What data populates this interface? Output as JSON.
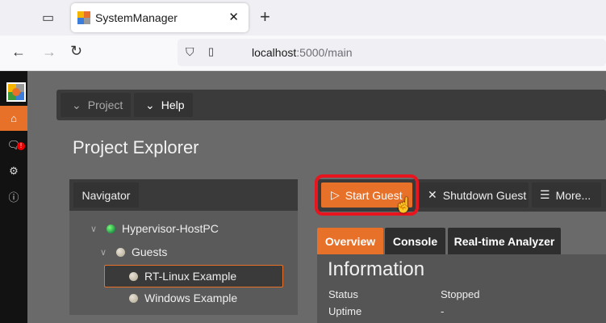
{
  "browser": {
    "tab_title": "SystemManager",
    "url_host": "localhost",
    "url_path": ":5000/main"
  },
  "menu": {
    "project": "Project",
    "help": "Help"
  },
  "page_title": "Project Explorer",
  "navigator": {
    "label": "Navigator",
    "tree": [
      {
        "label": "Hypervisor-HostPC",
        "status": "green"
      },
      {
        "label": "Guests"
      },
      {
        "label": "RT-Linux Example",
        "selected": true
      },
      {
        "label": "Windows Example"
      }
    ]
  },
  "toolbar": {
    "start": "Start Guest",
    "shutdown": "Shutdown Guest",
    "more": "More..."
  },
  "tabs": [
    "Overview",
    "Console",
    "Real-time Analyzer"
  ],
  "info": {
    "heading": "Information",
    "rows": [
      {
        "k": "Status",
        "v": "Stopped"
      },
      {
        "k": "Uptime",
        "v": "-"
      }
    ]
  },
  "notification_badge": "!",
  "colors": {
    "accent": "#e8712a",
    "highlight": "#e8141e"
  }
}
